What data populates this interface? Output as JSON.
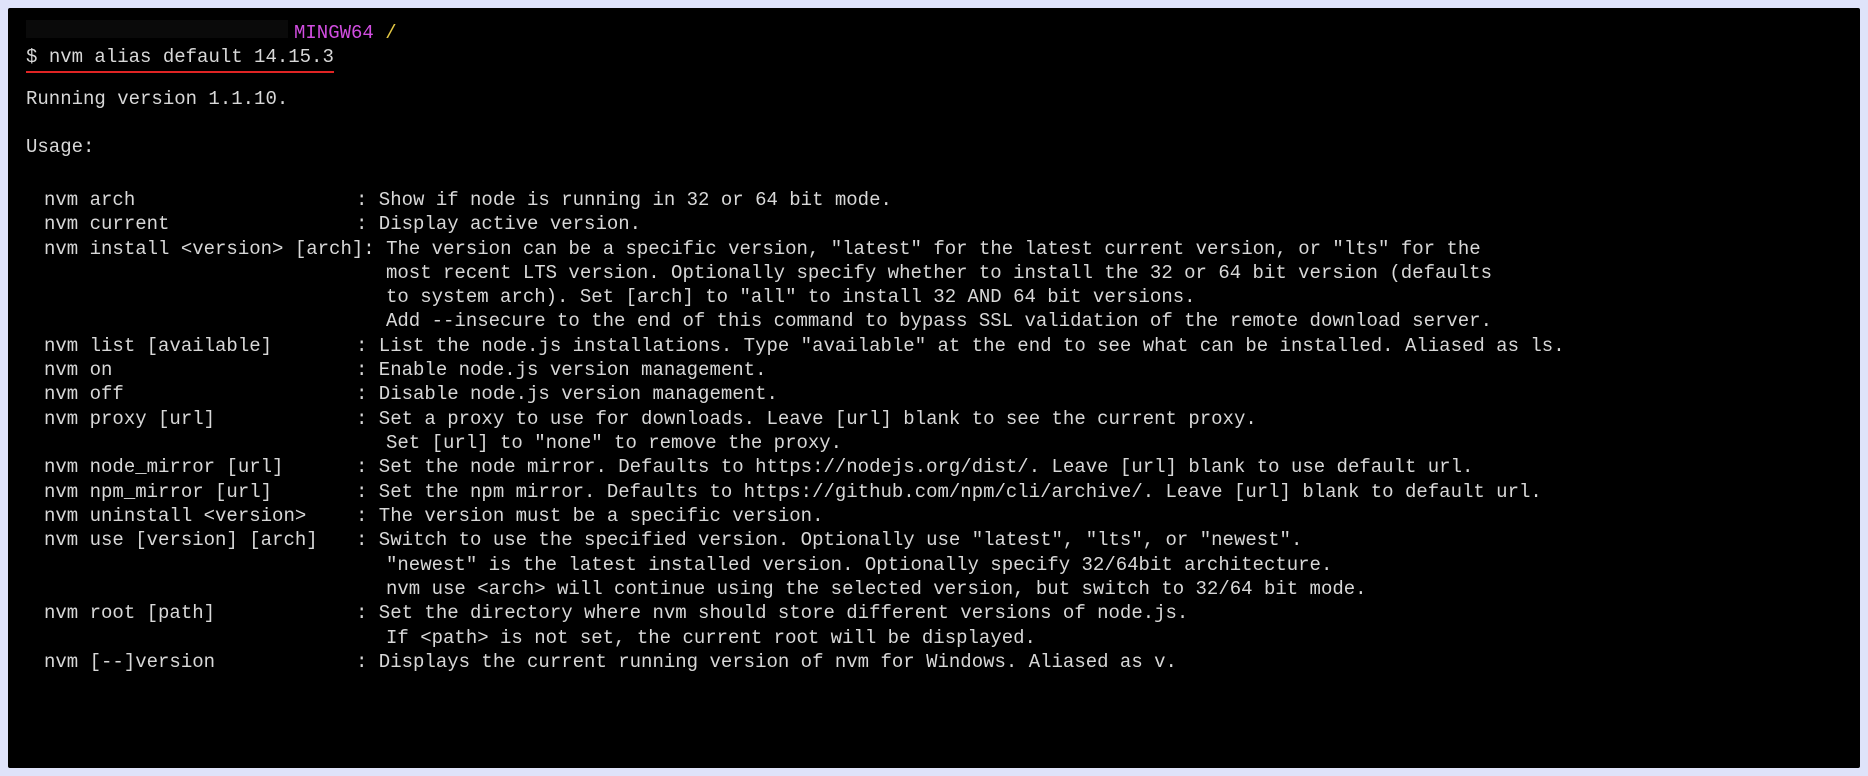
{
  "prompt": {
    "mingw_label": "MINGW64",
    "path": "/",
    "dollar": "$",
    "command": "nvm alias default 14.15.3"
  },
  "output": {
    "running": "Running version 1.1.10.",
    "usage_header": "Usage:"
  },
  "usage": [
    {
      "cmd": "nvm arch",
      "desc": "Show if node is running in 32 or 64 bit mode."
    },
    {
      "cmd": "nvm current",
      "desc": "Display active version."
    },
    {
      "cmd": "nvm install <version> [arch]",
      "desc": "The version can be a specific version, \"latest\" for the latest current version, or \"lts\" for the"
    },
    {
      "cont": "most recent LTS version. Optionally specify whether to install the 32 or 64 bit version (defaults"
    },
    {
      "cont": "to system arch). Set [arch] to \"all\" to install 32 AND 64 bit versions."
    },
    {
      "cont": "Add --insecure to the end of this command to bypass SSL validation of the remote download server."
    },
    {
      "cmd": "nvm list [available]",
      "desc": "List the node.js installations. Type \"available\" at the end to see what can be installed. Aliased as ls."
    },
    {
      "cmd": "nvm on",
      "desc": "Enable node.js version management."
    },
    {
      "cmd": "nvm off",
      "desc": "Disable node.js version management."
    },
    {
      "cmd": "nvm proxy [url]",
      "desc": "Set a proxy to use for downloads. Leave [url] blank to see the current proxy."
    },
    {
      "cont": "Set [url] to \"none\" to remove the proxy."
    },
    {
      "cmd": "nvm node_mirror [url]",
      "desc": "Set the node mirror. Defaults to https://nodejs.org/dist/. Leave [url] blank to use default url."
    },
    {
      "cmd": "nvm npm_mirror [url]",
      "desc": "Set the npm mirror. Defaults to https://github.com/npm/cli/archive/. Leave [url] blank to default url."
    },
    {
      "cmd": "nvm uninstall <version>",
      "desc": "The version must be a specific version."
    },
    {
      "cmd": "nvm use [version] [arch]",
      "desc": "Switch to use the specified version. Optionally use \"latest\", \"lts\", or \"newest\"."
    },
    {
      "cont": "\"newest\" is the latest installed version. Optionally specify 32/64bit architecture."
    },
    {
      "cont": "nvm use <arch> will continue using the selected version, but switch to 32/64 bit mode."
    },
    {
      "cmd": "nvm root [path]",
      "desc": "Set the directory where nvm should store different versions of node.js."
    },
    {
      "cont": "If <path> is not set, the current root will be displayed."
    },
    {
      "cmd": "nvm [--]version",
      "desc": "Displays the current running version of nvm for Windows. Aliased as v."
    }
  ]
}
